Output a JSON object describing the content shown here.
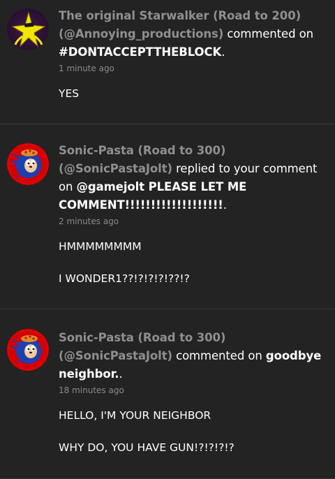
{
  "notifications": [
    {
      "user_name": "The original Starwalker (Road to 200)",
      "user_handle": "(@Annoying_productions)",
      "action": "commented on",
      "target": "#DONTACCEPTTHEBLOCK",
      "target_suffix": ".",
      "time": "1 minute ago",
      "lines": [
        "YES"
      ],
      "avatar_icon": "starwalker-star-icon"
    },
    {
      "user_name": "Sonic-Pasta (Road to 300)",
      "user_handle": "(@SonicPastaJolt)",
      "action": "replied to your comment on",
      "target": "@gamejolt PLEASE LET ME COMMENT!!!!!!!!!!!!!!!!!!!",
      "target_suffix": ".",
      "time": "2 minutes ago",
      "lines": [
        "HMMMMMMMM",
        "I WONDER1??!?!?!?!??!?"
      ],
      "avatar_icon": "sonic-pasta-icon"
    },
    {
      "user_name": "Sonic-Pasta (Road to 300)",
      "user_handle": "(@SonicPastaJolt)",
      "action": "commented on",
      "target": "goodbye neighbor.",
      "target_suffix": ".",
      "time": "18 minutes ago",
      "lines": [
        "HELLO, I'M YOUR NEIGHBOR",
        "WHY DO, YOU HAVE GUN!?!?!?!?"
      ],
      "avatar_icon": "sonic-pasta-icon"
    }
  ],
  "colors": {
    "background": "#232323",
    "divider": "#363636",
    "muted_link": "#8f8f8f",
    "timestamp": "#8a8a8a",
    "text": "#ffffff"
  }
}
